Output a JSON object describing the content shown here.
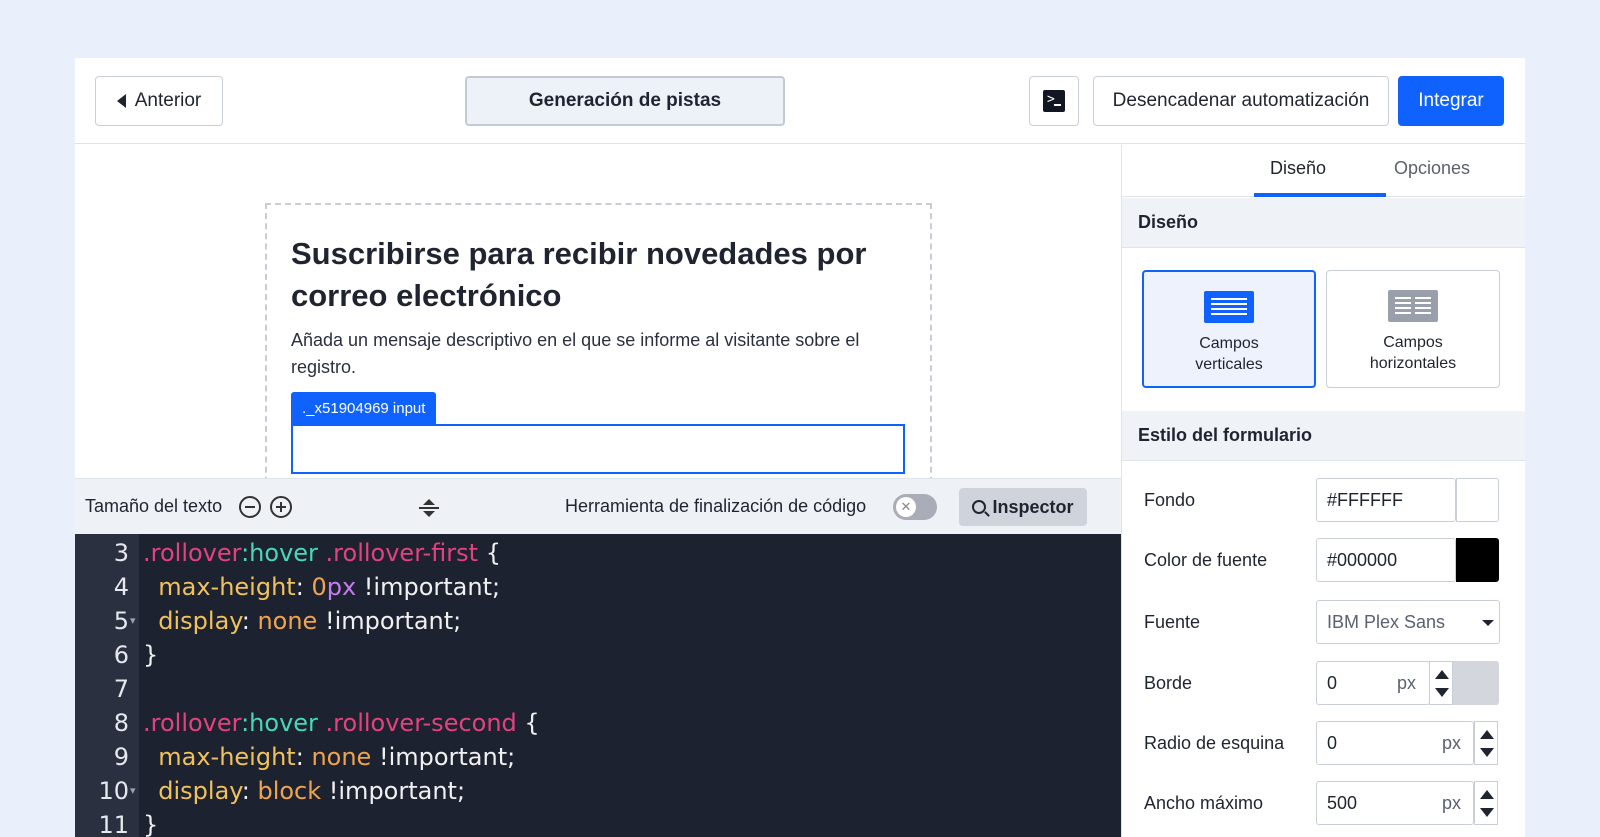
{
  "toolbar": {
    "back_label": "Anterior",
    "page_title": "Generación de pistas",
    "trigger_label": "Desencadenar automatización",
    "integrate_label": "Integrar",
    "terminal_icon": "terminal-icon"
  },
  "canvas": {
    "form_title": "Suscribirse para recibir novedades por correo electrónico",
    "form_description": "Añada un mensaje descriptivo en el que se informe al visitante sobre el registro.",
    "selected_tag": "._x51904969 input"
  },
  "editor": {
    "text_size_label": "Tamaño del texto",
    "completion_label": "Herramienta de finalización de código",
    "completion_enabled": false,
    "inspector_label": "Inspector",
    "lines": [
      {
        "n": "3",
        "fold": false,
        "tokens": [
          {
            "t": ".rollover",
            "c": "c-sel"
          },
          {
            "t": ":hover",
            "c": "c-pse"
          },
          {
            "t": " .rollover-first",
            "c": "c-sel"
          },
          {
            "t": " {",
            "c": "c-imp"
          }
        ]
      },
      {
        "n": "4",
        "fold": false,
        "tokens": [
          {
            "t": "  max-height",
            "c": "c-prop"
          },
          {
            "t": ": ",
            "c": "c-imp"
          },
          {
            "t": "0",
            "c": "c-val"
          },
          {
            "t": "px",
            "c": "c-num"
          },
          {
            "t": " !important;",
            "c": "c-imp"
          }
        ]
      },
      {
        "n": "5",
        "fold": true,
        "tokens": [
          {
            "t": "  display",
            "c": "c-prop"
          },
          {
            "t": ": ",
            "c": "c-imp"
          },
          {
            "t": "none",
            "c": "c-val"
          },
          {
            "t": " !important;",
            "c": "c-imp"
          }
        ]
      },
      {
        "n": "6",
        "fold": false,
        "tokens": [
          {
            "t": "}",
            "c": "c-imp"
          }
        ]
      },
      {
        "n": "7",
        "fold": false,
        "tokens": []
      },
      {
        "n": "8",
        "fold": false,
        "tokens": [
          {
            "t": ".rollover",
            "c": "c-sel"
          },
          {
            "t": ":hover",
            "c": "c-pse"
          },
          {
            "t": " .rollover-second",
            "c": "c-sel"
          },
          {
            "t": " {",
            "c": "c-imp"
          }
        ]
      },
      {
        "n": "9",
        "fold": false,
        "tokens": [
          {
            "t": "  max-height",
            "c": "c-prop"
          },
          {
            "t": ": ",
            "c": "c-imp"
          },
          {
            "t": "none",
            "c": "c-val"
          },
          {
            "t": " !important;",
            "c": "c-imp"
          }
        ]
      },
      {
        "n": "10",
        "fold": true,
        "tokens": [
          {
            "t": "  display",
            "c": "c-prop"
          },
          {
            "t": ": ",
            "c": "c-imp"
          },
          {
            "t": "block",
            "c": "c-val"
          },
          {
            "t": " !important;",
            "c": "c-imp"
          }
        ]
      },
      {
        "n": "11",
        "fold": false,
        "tokens": [
          {
            "t": "}",
            "c": "c-imp"
          }
        ]
      }
    ]
  },
  "panel": {
    "tab_design": "Diseño",
    "tab_options": "Opciones",
    "section_design": "Diseño",
    "layout_vertical": "Campos verticales",
    "layout_horizontal": "Campos horizontales",
    "section_style": "Estilo del formulario",
    "background_label": "Fondo",
    "background_value": "#FFFFFF",
    "font_color_label": "Color de fuente",
    "font_color_value": "#000000",
    "font_label": "Fuente",
    "font_value": "IBM Plex Sans",
    "border_label": "Borde",
    "border_value": "0",
    "radius_label": "Radio de esquina",
    "radius_value": "0",
    "max_width_label": "Ancho máximo",
    "max_width_value": "500",
    "unit": "px"
  },
  "colors": {
    "accent": "#0f62fe",
    "code_bg": "#1d2230",
    "page_bg": "#eaf0fb"
  }
}
